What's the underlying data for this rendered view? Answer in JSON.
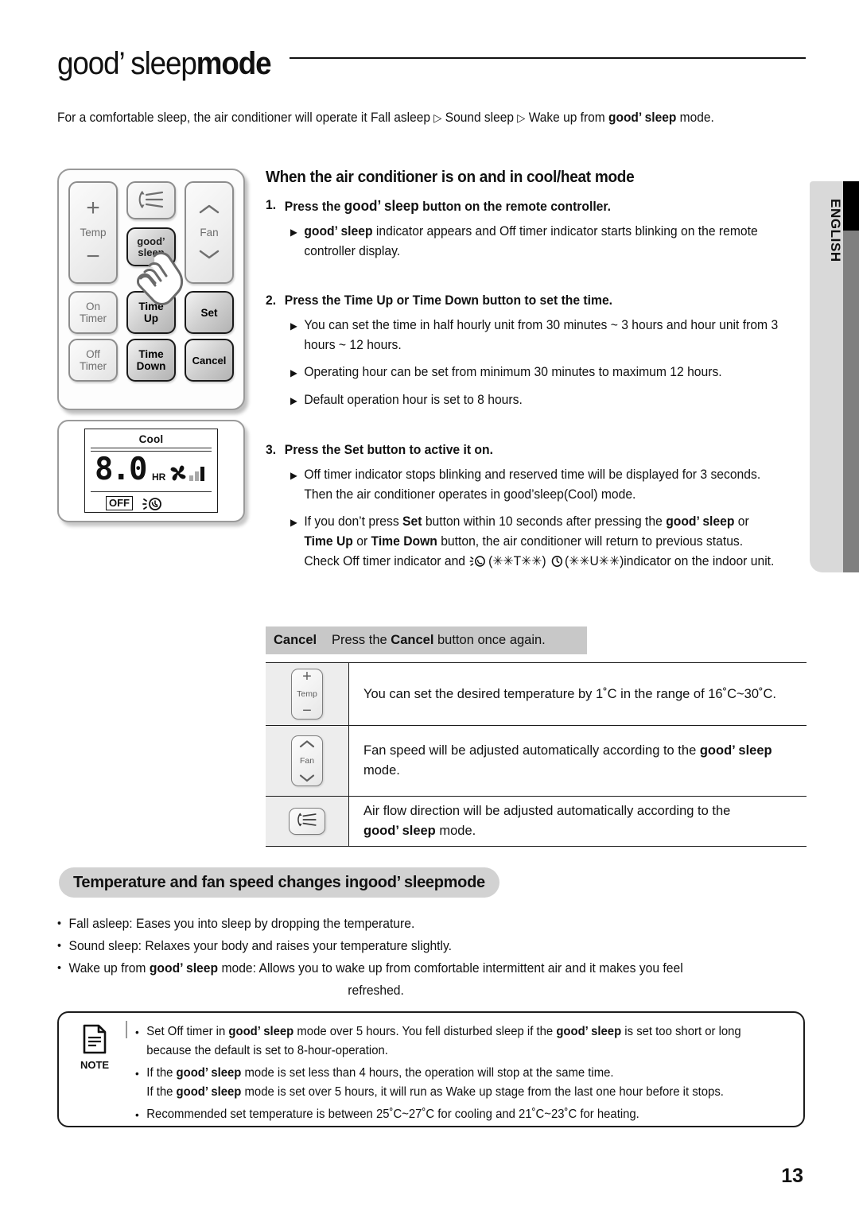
{
  "page": {
    "title_main": "good’ sleep",
    "title_bold": "mode",
    "page_number": "13",
    "side_tab_label": "ENGLISH"
  },
  "intro": {
    "part1": "For a comfortable sleep, the air conditioner will operate it Fall asleep ",
    "sep1": "▷",
    "part2": " Sound sleep ",
    "sep2": "▷",
    "part3": " Wake up from ",
    "brand": "good’ sleep",
    "part4": " mode."
  },
  "remote": {
    "buttons": {
      "temp_label": "Temp",
      "temp_plus": "+",
      "temp_minus": "−",
      "fan_label": "Fan",
      "fan_up": "⌃",
      "fan_down": "⌄",
      "swing": "airflow-direction-icon",
      "good_sleep_line1": "good’",
      "good_sleep_line2": "sleep",
      "on_timer_line1": "On",
      "on_timer_line2": "Timer",
      "time_up_line1": "Time",
      "time_up_line2": "Up",
      "set": "Set",
      "off_timer_line1": "Off",
      "off_timer_line2": "Timer",
      "time_down_line1": "Time",
      "time_down_line2": "Down",
      "cancel": "Cancel"
    }
  },
  "lcd": {
    "mode": "Cool",
    "value": "8.0",
    "unit": "HR",
    "fan_icon": "fan-blade-icon",
    "fan_bars": 3,
    "fan_bars_active": 1,
    "off_label": "OFF",
    "sleep_icon": "good-sleep-clock-icon"
  },
  "section1": {
    "heading": "When the air conditioner is on and in cool/heat mode",
    "steps": [
      {
        "num": "1.",
        "text_a": "Press the ",
        "brand": "good’ sleep",
        "text_b": " button on the remote controller.",
        "bullets": [
          {
            "brand_lead": "good’ sleep",
            "text": " indicator appears and Off timer indicator starts blinking on the remote controller display."
          }
        ]
      },
      {
        "num": "2.",
        "text_a": "Press the ",
        "bold1": "Time Up",
        "mid": " or ",
        "bold2": "Time Down",
        "text_b": " button to set the time.",
        "bullets": [
          {
            "text": "You can set the time in half hourly unit from 30 minutes ~ 3 hours and hour unit from 3 hours ~ 12 hours."
          },
          {
            "text": "Operating hour can be set from minimum 30 minutes to maximum 12 hours."
          },
          {
            "text": "Default operation hour is set to 8 hours."
          }
        ]
      },
      {
        "num": "3.",
        "text_a": "Press the ",
        "bold1": "Set",
        "text_b": " button to active it on.",
        "bullets": [
          {
            "text": "Off timer indicator stops blinking and reserved time will be displayed for 3 seconds. Then the air conditioner operates in good’sleep(Cool) mode."
          },
          {
            "text": "If you don’t press Set button within 10 seconds after pressing the good’ sleep or Time Up or Time Down button, the air conditioner will return to previous status. Check Off timer indicator and (✳✳T✳✳) (✳✳U✳✳)indicator on the indoor unit."
          }
        ]
      }
    ]
  },
  "cancel_row": {
    "label": "Cancel",
    "text_a": "Press the ",
    "bold": "Cancel",
    "text_b": " button once again."
  },
  "table": {
    "rows": [
      {
        "icon_name": "temp-button-icon",
        "icon_plus": "+",
        "icon_label": "Temp",
        "icon_minus": "−",
        "text": "You can set the desired temperature by 1˚C in the range of 16˚C~30˚C."
      },
      {
        "icon_name": "fan-button-icon",
        "icon_up": "⌃",
        "icon_label": "Fan",
        "icon_down": "⌄",
        "text_a": "Fan speed will be adjusted automatically according to the ",
        "brand": "good’ sleep",
        "text_b": " mode."
      },
      {
        "icon_name": "airflow-direction-button-icon",
        "text_a": "Air flow direction will be adjusted automatically according to the ",
        "brand": "good’ sleep",
        "text_b": " mode."
      }
    ]
  },
  "section2": {
    "heading_a": "Temperature and fan speed changes in ",
    "heading_brand": "good’ sleep",
    "heading_b": " mode",
    "bullets": [
      {
        "text": "Fall asleep: Eases you into sleep by dropping the temperature."
      },
      {
        "text": "Sound sleep: Relaxes your body and raises your temperature slightly."
      },
      {
        "text_a": "Wake up from ",
        "brand": "good’ sleep",
        "text_b": " mode: Allows you to wake up from comfortable intermittent air and it makes you feel",
        "text_c": "refreshed."
      }
    ]
  },
  "note": {
    "label": "NOTE",
    "icon_name": "document-note-icon",
    "items": [
      {
        "a": "Set Off timer in ",
        "b1": "good’ sleep",
        "c": " mode over 5 hours. You fell disturbed sleep if the ",
        "b2": "good’ sleep",
        "d": " is set too short or long because the default is set to 8-hour-operation."
      },
      {
        "a": "If the ",
        "b1": "good’ sleep",
        "c": " mode is set less than 4 hours, the operation will stop at the same time.",
        "line2_a": "If the ",
        "line2_b": "good’ sleep",
        "line2_c": " mode is set over 5 hours, it will run as Wake up stage from the last one hour before it stops."
      },
      {
        "a": "Recommended set temperature is between 25˚C~27˚C for cooling and 21˚C~23˚C for heating."
      }
    ]
  }
}
